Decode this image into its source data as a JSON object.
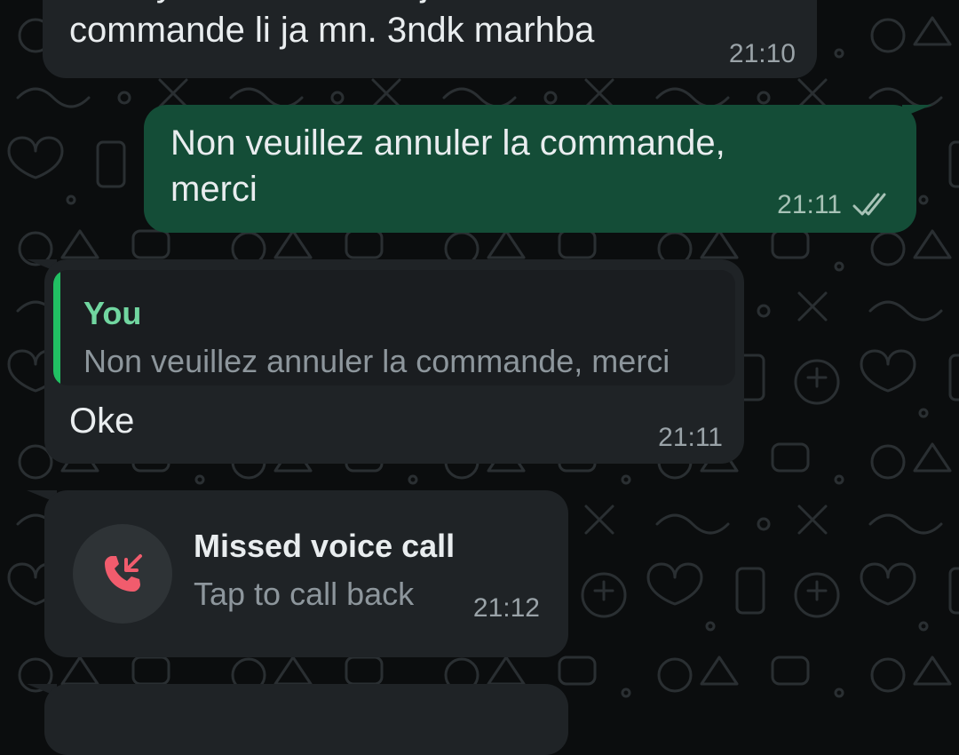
{
  "messages": [
    {
      "direction": "incoming",
      "lines": [
        "Makayhch mochkil tahjib lk la",
        "commande li ja mn. 3ndk marhba"
      ],
      "time": "21:10"
    },
    {
      "direction": "outgoing",
      "lines": [
        "Non veuillez annuler la commande,",
        "merci"
      ],
      "time": "21:11",
      "status_icon": "double-check-icon"
    },
    {
      "direction": "incoming",
      "quote": {
        "author": "You",
        "text": "Non veuillez annuler la commande, merci"
      },
      "lines": [
        "Oke"
      ],
      "time": "21:11"
    },
    {
      "direction": "incoming",
      "type": "missed-call",
      "title": "Missed voice call",
      "subtitle": "Tap to call back",
      "time": "21:12",
      "icon": "missed-call-icon"
    }
  ],
  "colors": {
    "background": "#0b0d0e",
    "incoming_bubble": "#1f2326",
    "outgoing_bubble": "#144d37",
    "quote_bar": "#21c063",
    "quote_author": "#71d6a0",
    "missed_call": "#f15c6d"
  }
}
